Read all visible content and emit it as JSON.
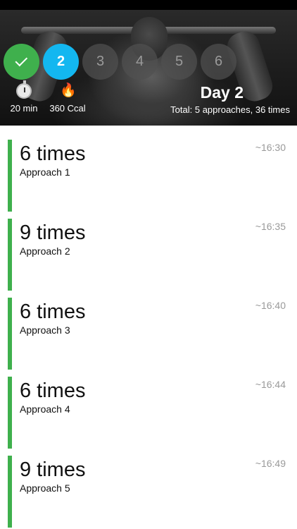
{
  "steps": [
    {
      "label": "",
      "state": "done",
      "icon": "check-icon"
    },
    {
      "label": "2",
      "state": "current"
    },
    {
      "label": "3",
      "state": "pending"
    },
    {
      "label": "4",
      "state": "pending"
    },
    {
      "label": "5",
      "state": "pending"
    },
    {
      "label": "6",
      "state": "pending"
    }
  ],
  "stats": {
    "duration": {
      "icon": "stopwatch-icon",
      "label": "20 min"
    },
    "calories": {
      "icon": "fire-icon",
      "label": "360 Ccal"
    }
  },
  "day": {
    "title": "Day 2",
    "total": "Total: 5 approaches, 36 times"
  },
  "approaches": [
    {
      "count": "6 times",
      "label": "Approach 1",
      "time": "~16:30"
    },
    {
      "count": "9 times",
      "label": "Approach 2",
      "time": "~16:35"
    },
    {
      "count": "6 times",
      "label": "Approach 3",
      "time": "~16:40"
    },
    {
      "count": "6 times",
      "label": "Approach 4",
      "time": "~16:44"
    },
    {
      "count": "9 times",
      "label": "Approach 5",
      "time": "~16:49"
    }
  ],
  "colors": {
    "accent_green": "#3fb04d",
    "current_blue": "#13b7f0",
    "pending_gray": "#505050"
  }
}
